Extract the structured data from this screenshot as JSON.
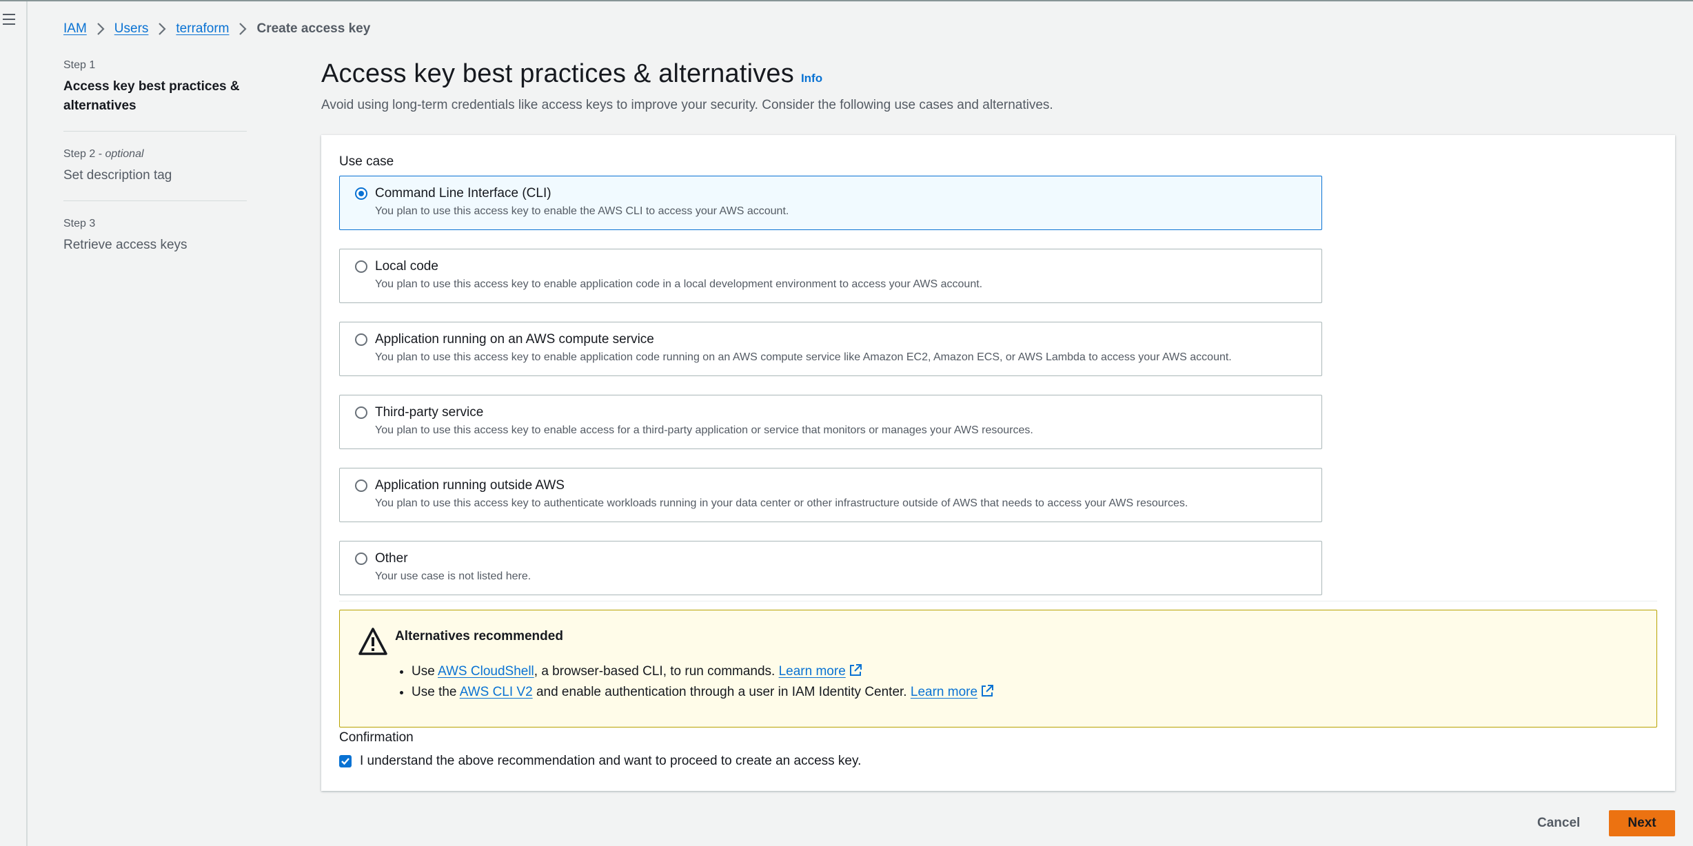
{
  "breadcrumb": {
    "iam": "IAM",
    "users": "Users",
    "user": "terraform",
    "current": "Create access key"
  },
  "steps": [
    {
      "num": "Step 1",
      "optional": "",
      "title": "Access key best practices & alternatives"
    },
    {
      "num": "Step 2",
      "optional": "optional",
      "title": "Set description tag"
    },
    {
      "num": "Step 3",
      "optional": "",
      "title": "Retrieve access keys"
    }
  ],
  "page": {
    "title": "Access key best practices & alternatives",
    "info": "Info",
    "description": "Avoid using long-term credentials like access keys to improve your security. Consider the following use cases and alternatives."
  },
  "use_case": {
    "label": "Use case",
    "selected_index": 0,
    "options": [
      {
        "title": "Command Line Interface (CLI)",
        "desc": "You plan to use this access key to enable the AWS CLI to access your AWS account."
      },
      {
        "title": "Local code",
        "desc": "You plan to use this access key to enable application code in a local development environment to access your AWS account."
      },
      {
        "title": "Application running on an AWS compute service",
        "desc": "You plan to use this access key to enable application code running on an AWS compute service like Amazon EC2, Amazon ECS, or AWS Lambda to access your AWS account."
      },
      {
        "title": "Third-party service",
        "desc": "You plan to use this access key to enable access for a third-party application or service that monitors or manages your AWS resources."
      },
      {
        "title": "Application running outside AWS",
        "desc": "You plan to use this access key to authenticate workloads running in your data center or other infrastructure outside of AWS that needs to access your AWS resources."
      },
      {
        "title": "Other",
        "desc": "Your use case is not listed here."
      }
    ]
  },
  "alert": {
    "title": "Alternatives recommended",
    "item1": {
      "pre": "Use ",
      "link": "AWS CloudShell",
      "mid": ", a browser-based CLI, to run commands. ",
      "learn": "Learn more"
    },
    "item2": {
      "pre": "Use the ",
      "link": "AWS CLI V2",
      "mid": " and enable authentication through a user in IAM Identity Center. ",
      "learn": "Learn more"
    }
  },
  "confirmation": {
    "label": "Confirmation",
    "checkbox_text": "I understand the above recommendation and want to proceed to create an access key.",
    "checked": true
  },
  "footer": {
    "cancel": "Cancel",
    "next": "Next"
  },
  "colors": {
    "accent": "#0972d3",
    "primary_button": "#ec7211",
    "warning_bg": "#fffce9",
    "warning_border": "#b8a200"
  }
}
